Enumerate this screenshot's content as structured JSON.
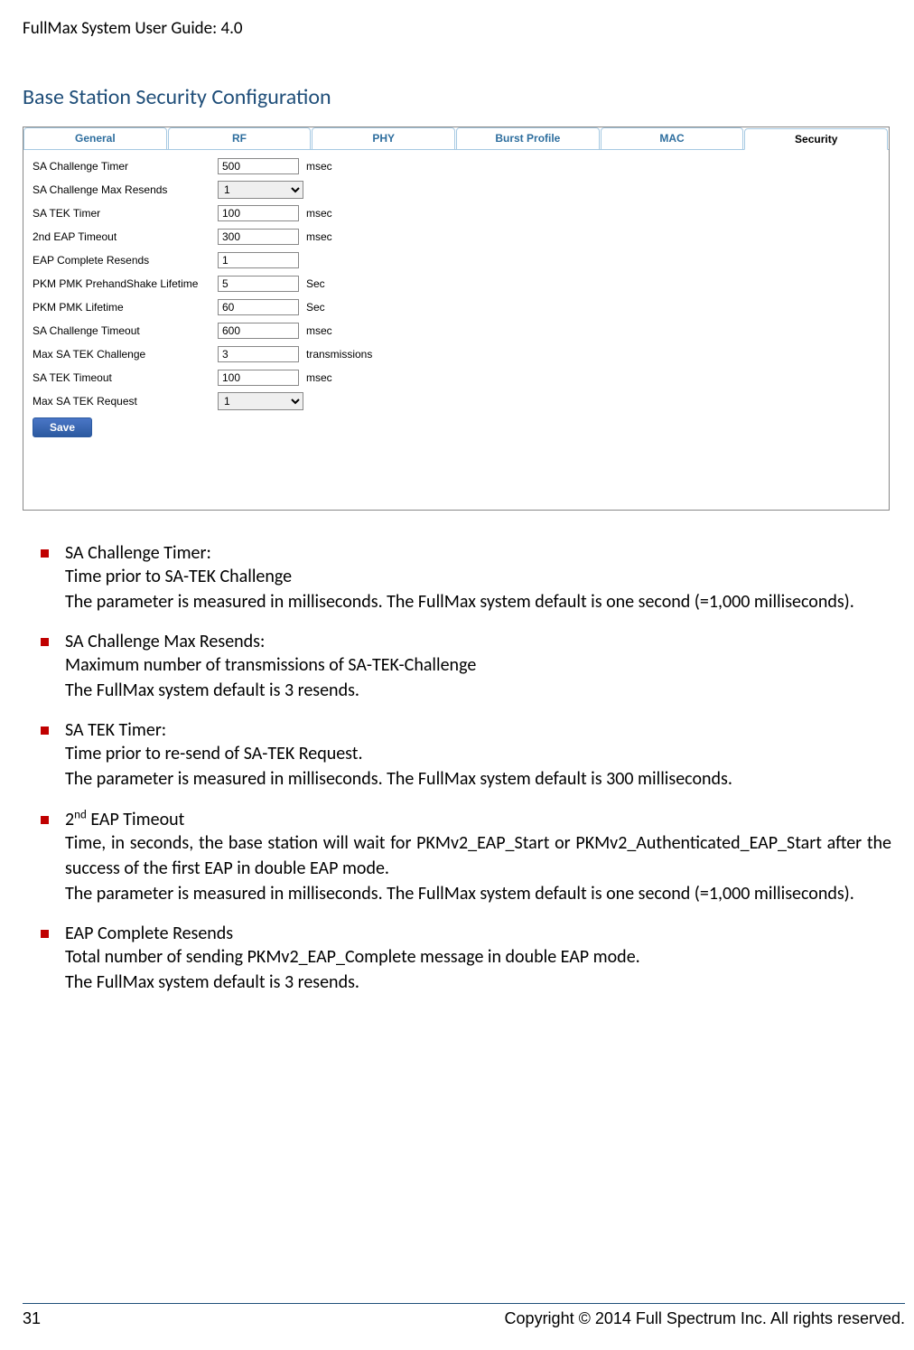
{
  "header": "FullMax System User Guide: 4.0",
  "section_title": "Base Station Security Configuration",
  "tabs": [
    "General",
    "RF",
    "PHY",
    "Burst Profile",
    "MAC",
    "Security"
  ],
  "active_tab": "Security",
  "form_rows": [
    {
      "label": "SA Challenge Timer",
      "value": "500",
      "unit": "msec",
      "type": "text"
    },
    {
      "label": "SA Challenge Max Resends",
      "value": "1",
      "unit": "",
      "type": "select"
    },
    {
      "label": "SA TEK Timer",
      "value": "100",
      "unit": "msec",
      "type": "text"
    },
    {
      "label": "2nd EAP Timeout",
      "value": "300",
      "unit": "msec",
      "type": "text"
    },
    {
      "label": "EAP Complete Resends",
      "value": "1",
      "unit": "",
      "type": "text"
    },
    {
      "label": "PKM PMK PrehandShake Lifetime",
      "value": "5",
      "unit": "Sec",
      "type": "text"
    },
    {
      "label": "PKM PMK Lifetime",
      "value": "60",
      "unit": "Sec",
      "type": "text"
    },
    {
      "label": "SA Challenge Timeout",
      "value": "600",
      "unit": "msec",
      "type": "text"
    },
    {
      "label": "Max SA TEK Challenge",
      "value": "3",
      "unit": "transmissions",
      "type": "text"
    },
    {
      "label": "SA TEK Timeout",
      "value": "100",
      "unit": "msec",
      "type": "text"
    },
    {
      "label": "Max SA TEK Request",
      "value": "1",
      "unit": "",
      "type": "select"
    }
  ],
  "save_label": "Save",
  "bullets": [
    {
      "title": "SA Challenge Timer:",
      "lines": [
        "Time prior to SA-TEK Challenge",
        "The parameter is measured in milliseconds. The FullMax system default is one second (=1,000 milliseconds)."
      ]
    },
    {
      "title": "SA Challenge Max Resends:",
      "lines": [
        "Maximum number of transmissions of SA-TEK-Challenge",
        "The FullMax system default is 3 resends."
      ]
    },
    {
      "title": "SA TEK Timer:",
      "lines": [
        "Time prior to re-send of SA-TEK Request.",
        "The parameter is measured in milliseconds. The FullMax system default is 300 milliseconds."
      ]
    },
    {
      "title_html": "2<span class='sup'>nd</span> EAP Timeout",
      "title": "2nd EAP Timeout",
      "lines": [
        "Time, in seconds, the base station will wait for PKMv2_EAP_Start or PKMv2_Authenticated_EAP_Start after the success of the first EAP in double EAP mode.",
        "The parameter is measured in milliseconds. The FullMax system default is one second (=1,000 milliseconds)."
      ]
    },
    {
      "title": "EAP Complete Resends",
      "lines": [
        "Total number of sending PKMv2_EAP_Complete message in double EAP mode.",
        "The FullMax system default is 3 resends."
      ]
    }
  ],
  "footer": {
    "page": "31",
    "copyright": "Copyright © 2014 Full Spectrum Inc. All rights reserved."
  }
}
